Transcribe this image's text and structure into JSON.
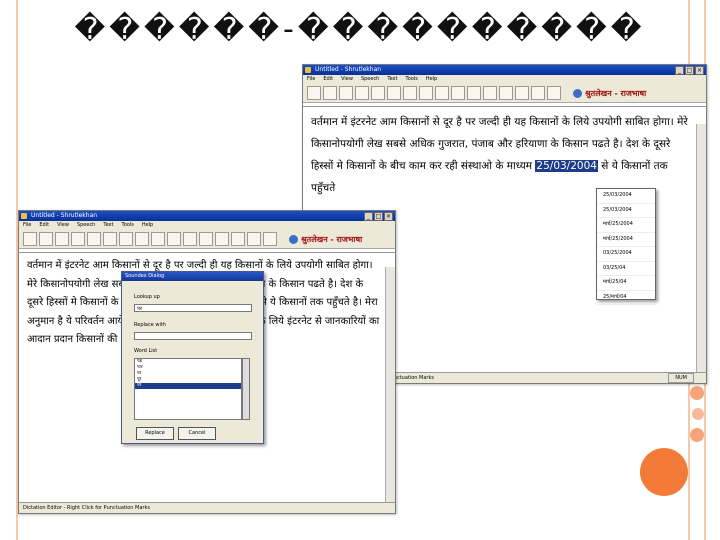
{
  "slide": {
    "title": "������-����������",
    "colors": {
      "frame": "#f4c9a8",
      "dot_large": "#f47a3a",
      "dot_small_1": "#f6a27a",
      "dot_small_2": "#f8b89a",
      "dot_small_3": "#f6a27a"
    }
  },
  "window_back": {
    "title": "Untitled - Shrutlekhan",
    "menu": [
      "File",
      "Edit",
      "View",
      "Speech",
      "Text",
      "Tools",
      "Help"
    ],
    "brand": "श्रुतलेखन - राजभाषा",
    "text_parts": [
      "वर्तमान में इंटरनेट आम किसानों से दूर है पर जल्दी ही यह किसानों के लिये उपयोगी साबित होगा। मेरे किसानोपयोगी लेख सबसे अधिक गुजरात, पंजाब और हरियाणा के किसान पढते है। देश के दूसरे हिस्सों मे किसानों के बीच काम कर रही संस्थाओ के माध्यम ",
      "25/03/2004",
      " से ये किसानों तक पहुँचते"
    ],
    "dropdown_items": [
      "25/03/2004",
      "25/03/2004",
      "मार्च/25/2004",
      "मार्च/25/2004",
      "03/25/2004",
      "03/25/04",
      "मार्च/25/04",
      "25/मार्च/04",
      "25/03/04"
    ],
    "status_left": "Dictation Editor - Right Click for Punctuation Marks",
    "status_num": "NUM"
  },
  "window_front": {
    "title": "Untitled - Shrutlekhan",
    "menu": [
      "File",
      "Edit",
      "View",
      "Speech",
      "Text",
      "Tools",
      "Help"
    ],
    "brand": "श्रुतलेखन - राजभाषा",
    "text_parts": [
      "वर्तमान में इंटरनेट आम किसानों से दूर है पर जल्दी ही यह किसानों के लिये उपयोगी साबित होगा। मेरे किसानोपयोगी लेख सबसे अधिक गुजरात, पंजाब और हरियाणा के किसान पढते है। देश के दूसरे हिस्सों मे किसानों के बीच काम कर रही संस्थाओ के माध्यम से ये किसानों तक पहुँचते है। मेरा अनुमान है ये परिवर्तन आयेगा और किसान बडी संख्या में ",
      "पर",
      " उसके लिये इंटरनेट से जानकारियों का आदान प्रदान किसानों की अपनी भाषा मे जानकारी नही है।"
    ],
    "status_left": "Dictation Editor - Right Click for Punctuation Marks"
  },
  "dialog": {
    "title": "Soundex Dialog",
    "lookup_label": "Lookup up",
    "lookup_value": "पर",
    "replace_label": "Replace with",
    "replace_value": "",
    "wordlist_label": "Word List",
    "words": [
      "पड़",
      "पार",
      "पर",
      "पूर",
      "पर"
    ],
    "replace_button": "Replace",
    "cancel_button": "Cancel"
  }
}
